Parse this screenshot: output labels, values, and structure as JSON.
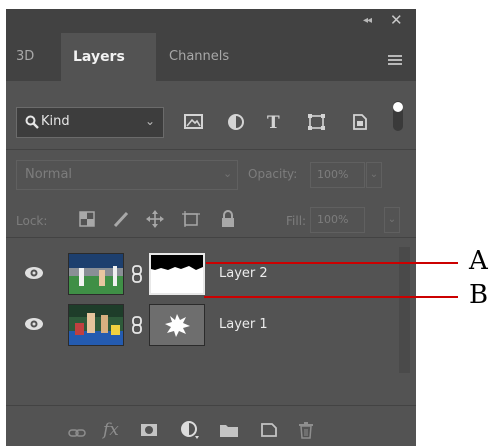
{
  "panel": {
    "titlebar": {
      "collapse_glyph": "◂◂",
      "close_glyph": "✕"
    },
    "tabs": [
      {
        "label": "3D",
        "active": false
      },
      {
        "label": "Layers",
        "active": true
      },
      {
        "label": "Channels",
        "active": false
      }
    ],
    "filter": {
      "kind_label": "Kind",
      "icons": [
        "pixel-layer-filter-icon",
        "adjustment-layer-filter-icon",
        "type-layer-filter-icon",
        "shape-layer-filter-icon",
        "smart-object-filter-icon",
        "filter-toggle-icon"
      ]
    },
    "blend": {
      "mode": "Normal",
      "opacity_label": "Opacity:",
      "opacity_value": "100%"
    },
    "lock": {
      "label": "Lock:",
      "fill_label": "Fill:",
      "fill_value": "100%",
      "icons": [
        "lock-transparent-pixels-icon",
        "lock-image-pixels-icon",
        "lock-position-icon",
        "lock-artboard-icon",
        "lock-all-icon"
      ]
    },
    "layers": [
      {
        "name": "Layer 2",
        "mask": "horizon",
        "visible": true
      },
      {
        "name": "Layer 1",
        "mask": "splat",
        "visible": true
      }
    ],
    "footer_icons": [
      "link-layers-icon",
      "fx-icon",
      "add-mask-icon",
      "adjustment-icon",
      "group-folder-icon",
      "new-layer-icon",
      "trash-icon"
    ],
    "footer_fx_text": "fx"
  },
  "callouts": [
    {
      "label": "A",
      "target": "Layer 2"
    },
    {
      "label": "B",
      "target": "Layer 1"
    }
  ],
  "colors": {
    "panel_bg": "#535353",
    "tabbar_bg": "#424242",
    "callout_line": "#cc0000"
  }
}
